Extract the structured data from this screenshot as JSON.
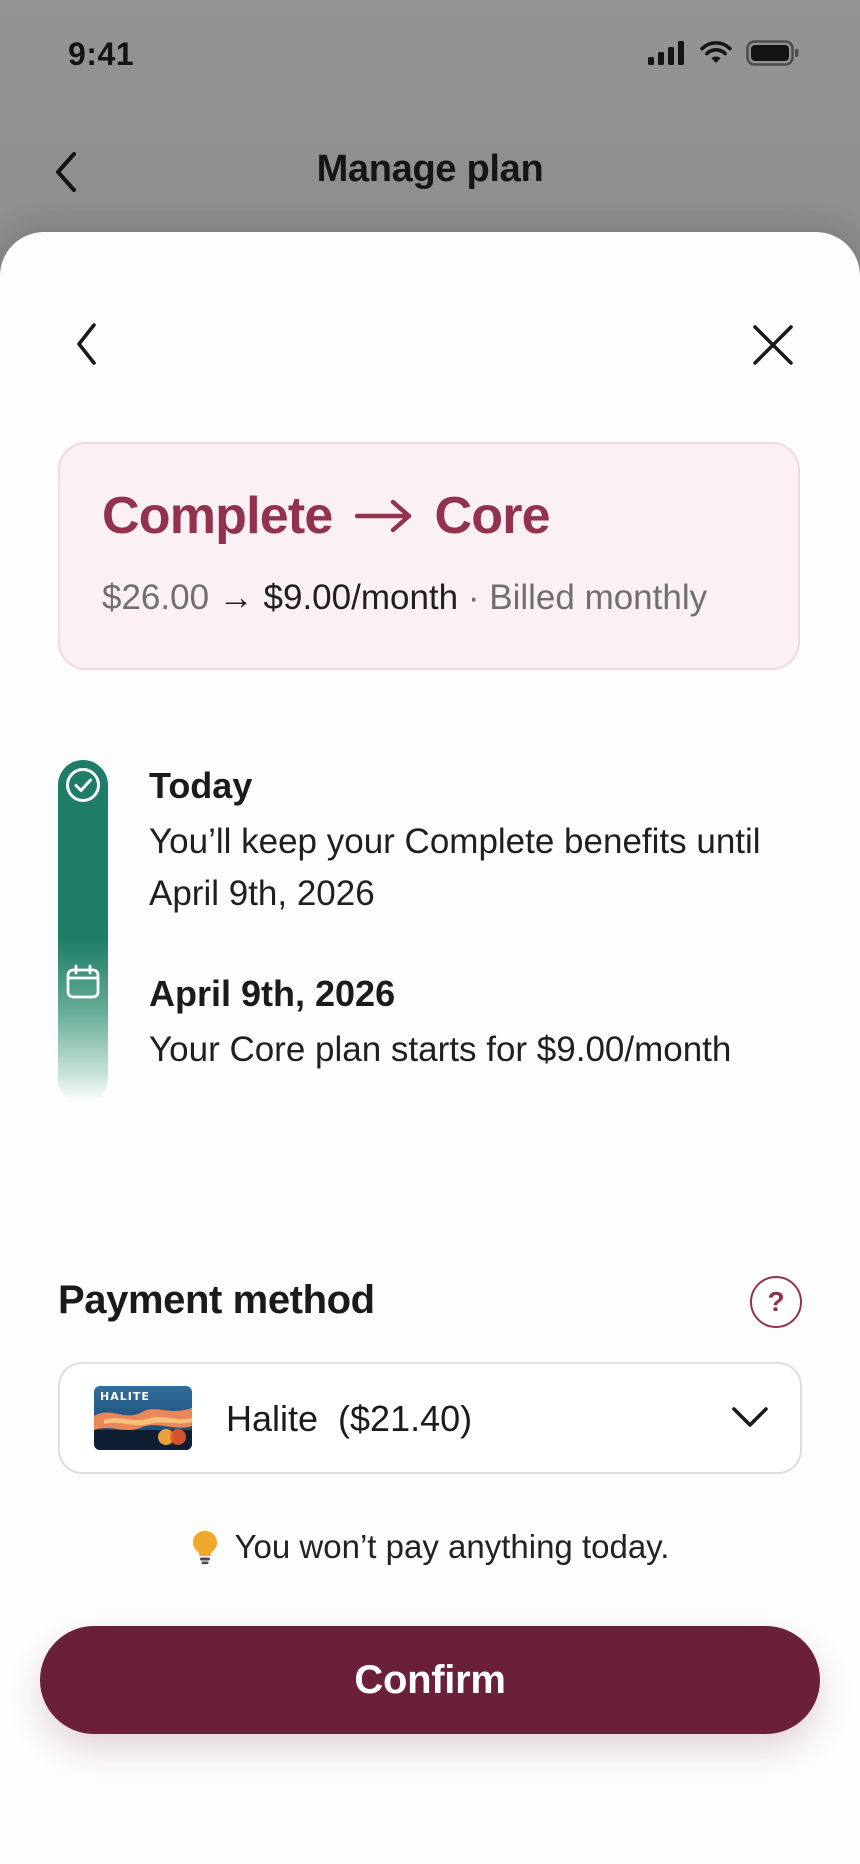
{
  "status_bar": {
    "time": "9:41"
  },
  "background_screen": {
    "title": "Manage plan"
  },
  "plan_change": {
    "from_plan": "Complete",
    "to_plan": "Core",
    "old_price": "$26.00",
    "new_price": "$9.00/month",
    "billing": "· Billed monthly"
  },
  "timeline": [
    {
      "heading": "Today",
      "body": "You’ll keep your Complete benefits until April 9th, 2026",
      "icon": "check-circle-icon"
    },
    {
      "heading": "April 9th, 2026",
      "body": "Your Core plan starts for $9.00/month",
      "icon": "calendar-icon"
    }
  ],
  "payment": {
    "label": "Payment method",
    "help_label": "?",
    "card_brand_text": "HALITE",
    "selected": "Halite  ($21.40)"
  },
  "info": {
    "text": "You won’t pay anything today.",
    "icon": "lightbulb-icon"
  },
  "confirm_label": "Confirm",
  "colors": {
    "accent": "#93324f",
    "button": "#6a1f3b",
    "timeline": "#1e7d66",
    "card_bg": "#fbf0f3"
  }
}
